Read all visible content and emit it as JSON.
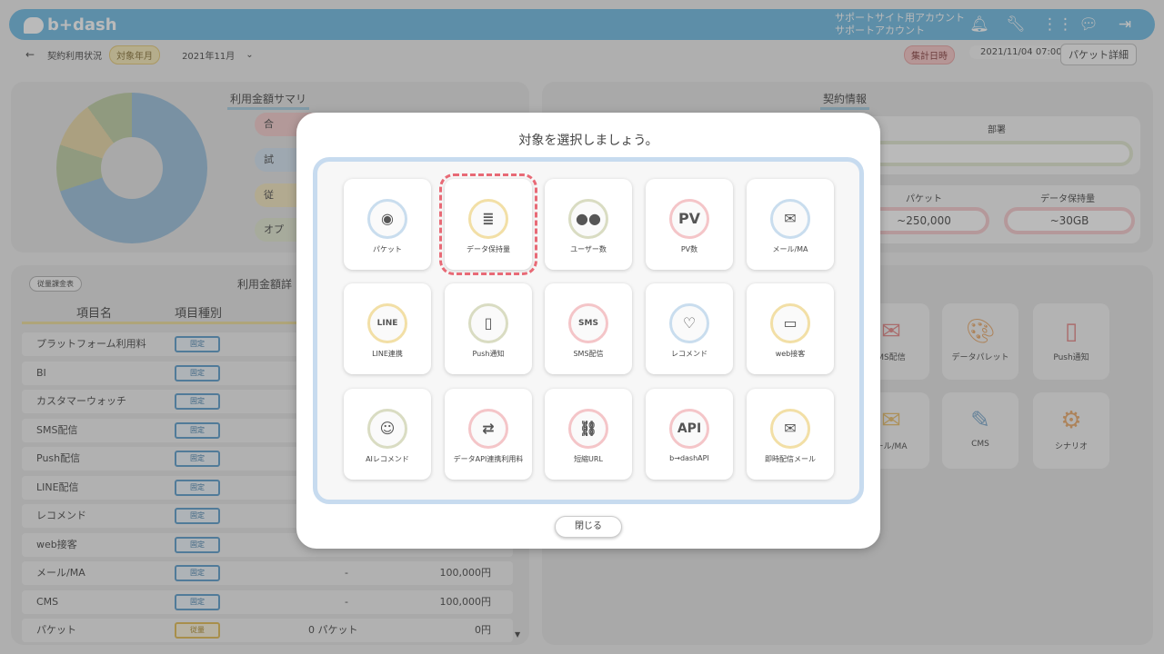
{
  "app": {
    "logo_text": "b+dash"
  },
  "header": {
    "account_line1": "サポートサイト用アカウント",
    "account_line2": "サポートアカウント",
    "icons": [
      "bell-icon",
      "wrench-icon",
      "grid-icon",
      "chat-icon",
      "logout-icon"
    ]
  },
  "subheader": {
    "back": "←",
    "title": "契約利用状況",
    "target_label": "対象年月",
    "month": "2021年11月",
    "aggregate_label": "集計日時",
    "aggregate_date": "2021/11/04 07:00",
    "detail_button": "パケット詳細"
  },
  "summary": {
    "title": "利用金額サマリ",
    "pills": [
      "合",
      "試",
      "従",
      "オプ"
    ]
  },
  "contract": {
    "title": "契約情報",
    "dept_label": "部署",
    "packet_label": "パケット",
    "packet_value": "~250,000",
    "data_label": "データ保持量",
    "data_value": "~30GB"
  },
  "detail": {
    "tab": "従量課金表",
    "title": "利用金額詳",
    "col_name": "項目名",
    "col_type": "項目種別",
    "rows": [
      {
        "name": "プラットフォーム利用料",
        "tag": "固定",
        "v1": "",
        "v2": ""
      },
      {
        "name": "BI",
        "tag": "固定",
        "v1": "",
        "v2": ""
      },
      {
        "name": "カスタマーウォッチ",
        "tag": "固定",
        "v1": "",
        "v2": ""
      },
      {
        "name": "SMS配信",
        "tag": "固定",
        "v1": "",
        "v2": ""
      },
      {
        "name": "Push配信",
        "tag": "固定",
        "v1": "",
        "v2": ""
      },
      {
        "name": "LINE配信",
        "tag": "固定",
        "v1": "",
        "v2": ""
      },
      {
        "name": "レコメンド",
        "tag": "固定",
        "v1": "",
        "v2": ""
      },
      {
        "name": "web接客",
        "tag": "固定",
        "v1": "",
        "v2": ""
      },
      {
        "name": "メール/MA",
        "tag": "固定",
        "v1": "-",
        "v2": "100,000円"
      },
      {
        "name": "CMS",
        "tag": "固定",
        "v1": "-",
        "v2": "100,000円"
      },
      {
        "name": "パケット",
        "tag": "従量",
        "v1": "0 パケット",
        "v2": "0円"
      }
    ]
  },
  "bg_apps": [
    {
      "label": "MS配信",
      "icon": "sms-icon"
    },
    {
      "label": "データパレット",
      "icon": "palette-icon"
    },
    {
      "label": "Push通知",
      "icon": "push-icon"
    },
    {
      "label": "ール/MA",
      "icon": "mail-icon"
    },
    {
      "label": "CMS",
      "icon": "cms-icon"
    },
    {
      "label": "シナリオ",
      "icon": "scenario-icon"
    }
  ],
  "modal": {
    "title": "対象を選択しましょう。",
    "close": "閉じる",
    "items": [
      {
        "label": "パケット",
        "glyph": "◉",
        "color": "c-blue"
      },
      {
        "label": "データ保持量",
        "glyph": "≣",
        "color": "c-yel"
      },
      {
        "label": "ユーザー数",
        "glyph": "●●",
        "color": "c-grn"
      },
      {
        "label": "PV数",
        "glyph": "PV",
        "color": "c-pink"
      },
      {
        "label": "メール/MA",
        "glyph": "✉",
        "color": "c-blue"
      },
      {
        "label": "LINE連携",
        "glyph": "LINE",
        "color": "c-yel"
      },
      {
        "label": "Push通知",
        "glyph": "▯",
        "color": "c-grn"
      },
      {
        "label": "SMS配信",
        "glyph": "SMS",
        "color": "c-pink"
      },
      {
        "label": "レコメンド",
        "glyph": "♡",
        "color": "c-blue"
      },
      {
        "label": "web接客",
        "glyph": "▭",
        "color": "c-yel"
      },
      {
        "label": "AIレコメンド",
        "glyph": "☺",
        "color": "c-grn"
      },
      {
        "label": "データAPI連携利用料",
        "glyph": "⇄",
        "color": "c-pink"
      },
      {
        "label": "短縮URL",
        "glyph": "⛓",
        "color": "c-pink"
      },
      {
        "label": "b→dashAPI",
        "glyph": "API",
        "color": "c-pink"
      },
      {
        "label": "即時配信メール",
        "glyph": "✉",
        "color": "c-yel"
      }
    ]
  }
}
